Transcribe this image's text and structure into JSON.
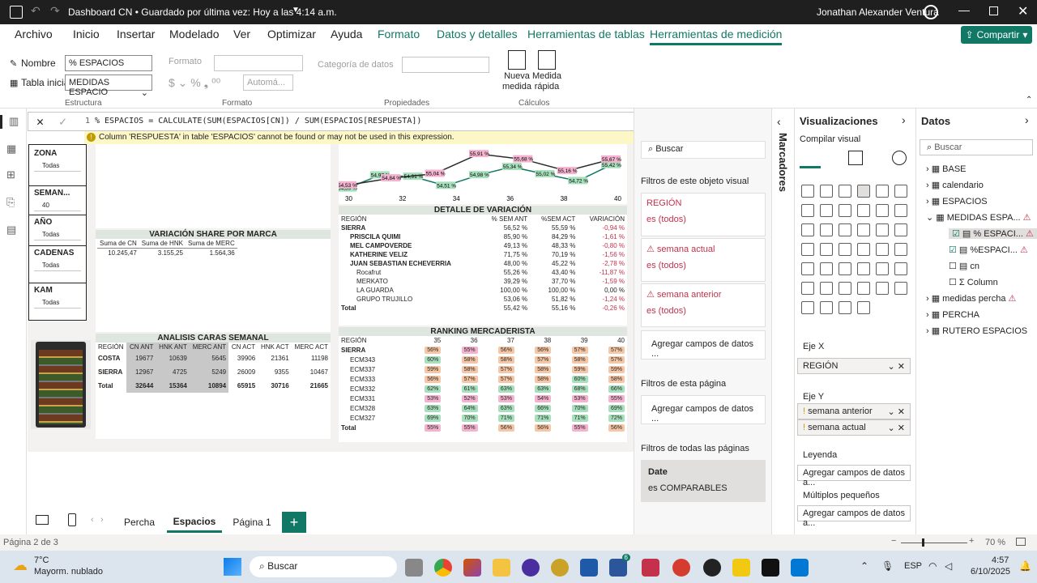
{
  "titlebar": {
    "title": "Dashboard CN • Guardado por última vez: Hoy a las 4:14 a.m.",
    "user": "Jonathan Alexander Ventura"
  },
  "menu": {
    "tabs": [
      "Archivo",
      "Inicio",
      "Insertar",
      "Modelado",
      "Ver",
      "Optimizar",
      "Ayuda",
      "Formato",
      "Datos y detalles",
      "Herramientas de tablas",
      "Herramientas de medición"
    ],
    "share": "Compartir"
  },
  "ribbon": {
    "nombre_label": "Nombre",
    "nombre_value": "% ESPACIOS",
    "tabla_label": "Tabla inicial",
    "tabla_value": "MEDIDAS ESPACIO",
    "formato_label": "Formato",
    "categoria_label": "Categoría de datos",
    "auto_label": "Automá...",
    "nueva_medida": "Nueva medida",
    "medida_rapida": "Medida rápida",
    "group_estructura": "Estructura",
    "group_formato": "Formato",
    "group_propiedades": "Propiedades",
    "group_calculos": "Cálculos"
  },
  "formula": {
    "line": "1",
    "text": "% ESPACIOS = CALCULATE(SUM(ESPACIOS[CN]) / SUM(ESPACIOS[RESPUESTA])",
    "error": "Column 'RESPUESTA' in table 'ESPACIOS' cannot be found or may not be used in this expression."
  },
  "slicers": [
    {
      "label": "ZONA",
      "value": "Todas"
    },
    {
      "label": "SEMAN...",
      "value": "40"
    },
    {
      "label": "AÑO",
      "value": "Todas"
    },
    {
      "label": "CADENAS",
      "value": "Todas"
    },
    {
      "label": "KAM",
      "value": "Todas"
    }
  ],
  "share_marca": {
    "title": "VARIACIÓN SHARE POR MARCA",
    "headers": [
      "Suma de CN",
      "Suma de HNK",
      "Suma de MERC"
    ],
    "values": [
      "10.245,47",
      "3.155,25",
      "1.564,36"
    ]
  },
  "line_chart": {
    "x_ticks": [
      "30",
      "32",
      "34",
      "36",
      "38",
      "40"
    ],
    "labels_pink": [
      "54,53 %",
      "54,84 %",
      "55,04 %",
      "55,91 %",
      "55,68 %",
      "55,16 %",
      "55,67 %"
    ],
    "labels_green": [
      "54,39 %",
      "54,97 %",
      "54,91 %",
      "54,51 %",
      "54,98 %",
      "55,34 %",
      "55,02 %",
      "54,72 %",
      "55,42 %"
    ]
  },
  "caras": {
    "title": "ANALISIS CARAS SEMANAL",
    "headers": [
      "REGIÓN",
      "CN ANT",
      "HNK ANT",
      "MERC ANT",
      "CN ACT",
      "HNK ACT",
      "MERC ACT"
    ],
    "rows": [
      [
        "COSTA",
        "19677",
        "10639",
        "5645",
        "39906",
        "21361",
        "11198"
      ],
      [
        "SIERRA",
        "12967",
        "4725",
        "5249",
        "26009",
        "9355",
        "10467"
      ],
      [
        "Total",
        "32644",
        "15364",
        "10894",
        "65915",
        "30716",
        "21665"
      ]
    ]
  },
  "variacion": {
    "title": "DETALLE DE VARIACIÓN",
    "headers": [
      "REGIÓN",
      "% SEM ANT",
      "%SEM ACT",
      "VARIACIÓN"
    ],
    "rows": [
      [
        "SIERRA",
        "56,52 %",
        "55,59 %",
        "-0,94 %"
      ],
      [
        "PRISCILA QUIMI",
        "85,90 %",
        "84,29 %",
        "-1,61 %"
      ],
      [
        "MEL CAMPOVERDE",
        "49,13 %",
        "48,33 %",
        "-0,80 %"
      ],
      [
        "KATHERINE VELIZ",
        "71,75 %",
        "70,19 %",
        "-1,56 %"
      ],
      [
        "JUAN SEBASTIAN ECHEVERRIA",
        "48,00 %",
        "45,22 %",
        "-2,78 %"
      ],
      [
        "Rocafrut",
        "55,26 %",
        "43,40 %",
        "-11,87 %"
      ],
      [
        "MERKATO",
        "39,29 %",
        "37,70 %",
        "-1,59 %"
      ],
      [
        "LA GUARDA",
        "100,00 %",
        "100,00 %",
        "0,00 %"
      ],
      [
        "GRUPO TRUJILLO",
        "53,06 %",
        "51,82 %",
        "-1,24 %"
      ],
      [
        "Total",
        "55,42 %",
        "55,16 %",
        "-0,26 %"
      ]
    ]
  },
  "ranking": {
    "title": "RANKING MERCADERISTA",
    "headers": [
      "REGIÓN",
      "35",
      "36",
      "37",
      "38",
      "39",
      "40"
    ],
    "rows": [
      [
        "SIERRA",
        "56%",
        "55%",
        "56%",
        "56%",
        "57%",
        "57%"
      ],
      [
        "ECM343",
        "60%",
        "58%",
        "58%",
        "57%",
        "58%",
        "57%"
      ],
      [
        "ECM337",
        "59%",
        "58%",
        "57%",
        "58%",
        "59%",
        "59%"
      ],
      [
        "ECM333",
        "56%",
        "57%",
        "57%",
        "58%",
        "60%",
        "58%"
      ],
      [
        "ECM332",
        "62%",
        "61%",
        "63%",
        "63%",
        "68%",
        "66%"
      ],
      [
        "ECM331",
        "53%",
        "52%",
        "53%",
        "54%",
        "53%",
        "55%"
      ],
      [
        "ECM328",
        "63%",
        "64%",
        "63%",
        "66%",
        "70%",
        "69%"
      ],
      [
        "ECM327",
        "69%",
        "70%",
        "71%",
        "71%",
        "71%",
        "72%"
      ],
      [
        "Total",
        "55%",
        "55%",
        "56%",
        "56%",
        "55%",
        "56%"
      ]
    ]
  },
  "pages": {
    "tabs": [
      "Percha",
      "Espacios",
      "Página 1"
    ],
    "active": "Espacios",
    "add": "+"
  },
  "status": {
    "page": "Página 2 de 3",
    "zoom": "70 %"
  },
  "filters": {
    "search": "Buscar",
    "card1_title": "REGIÓN",
    "card1_value": "es (todos)",
    "card2_title": "semana actual",
    "card2_value": "es (todos)",
    "card3_title": "semana anterior",
    "card3_value": "es (todos)",
    "add1": "Agregar campos de datos ...",
    "page_filters": "Filtros de esta página",
    "add2": "Agregar campos de datos ...",
    "all_pages": "Filtros de todas las páginas",
    "date_title": "Date",
    "date_value": "es COMPARABLES",
    "visual_filters": "Filtros de este objeto visual"
  },
  "marcadores": "Marcadores",
  "viz": {
    "title": "Visualizaciones",
    "sub": "Compilar visual",
    "ejex": "Eje X",
    "ejex_value": "REGIÓN",
    "ejey": "Eje Y",
    "ejey_v1": "semana anterior",
    "ejey_v2": "semana actual",
    "leyenda": "Leyenda",
    "leyenda_add": "Agregar campos de datos a...",
    "multiples": "Múltiplos pequeños",
    "multiples_add": "Agregar campos de datos a..."
  },
  "datos": {
    "title": "Datos",
    "search": "Buscar",
    "items": [
      "BASE",
      "calendario",
      "ESPACIOS",
      "MEDIDAS ESPA...",
      "% ESPACI...",
      "%ESPACI...",
      "cn",
      "Column",
      "medidas percha",
      "PERCHA",
      "RUTERO ESPACIOS"
    ]
  },
  "taskbar": {
    "temp": "7°C",
    "weather": "Mayorm. nublado",
    "search": "Buscar",
    "lang": "ESP",
    "time": "4:57",
    "date": "6/10/2025",
    "badge": "6"
  },
  "colors": {
    "accent": "#117865",
    "pink": "#f4b3cf",
    "green": "#a8e0bd"
  }
}
